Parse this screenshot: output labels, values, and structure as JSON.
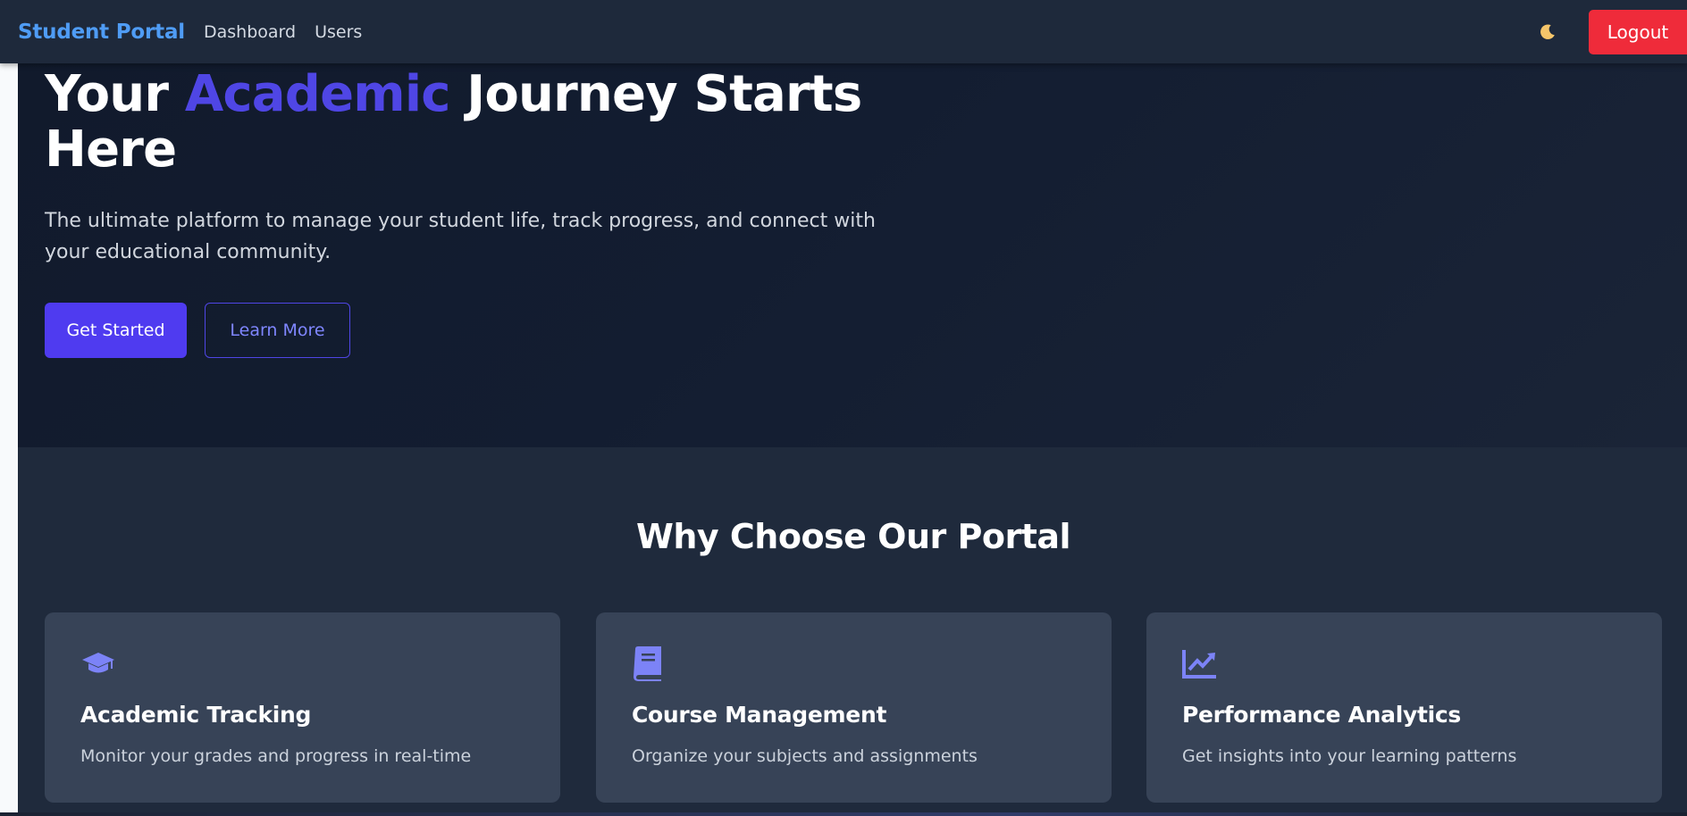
{
  "navbar": {
    "brand": "Student Portal",
    "links": [
      "Dashboard",
      "Users"
    ],
    "theme_icon": "moon-icon",
    "logout_label": "Logout"
  },
  "hero": {
    "title_before": "Your ",
    "title_accent": "Academic",
    "title_after": " Journey Starts Here",
    "subtitle": "The ultimate platform to manage your student life, track progress, and connect with your educational community.",
    "primary_button": "Get Started",
    "secondary_button": "Learn More"
  },
  "features": {
    "title": "Why Choose Our Portal",
    "cards": [
      {
        "icon": "graduation-cap-icon",
        "title": "Academic Tracking",
        "description": "Monitor your grades and progress in real-time"
      },
      {
        "icon": "book-icon",
        "title": "Course Management",
        "description": "Organize your subjects and assignments"
      },
      {
        "icon": "chart-line-icon",
        "title": "Performance Analytics",
        "description": "Get insights into your learning patterns"
      }
    ]
  },
  "colors": {
    "brand": "#4f9cf5",
    "accent": "#4f46e5",
    "primary_button": "#4f3bf0",
    "logout": "#ef2b3a",
    "icon": "#7c83f7"
  }
}
